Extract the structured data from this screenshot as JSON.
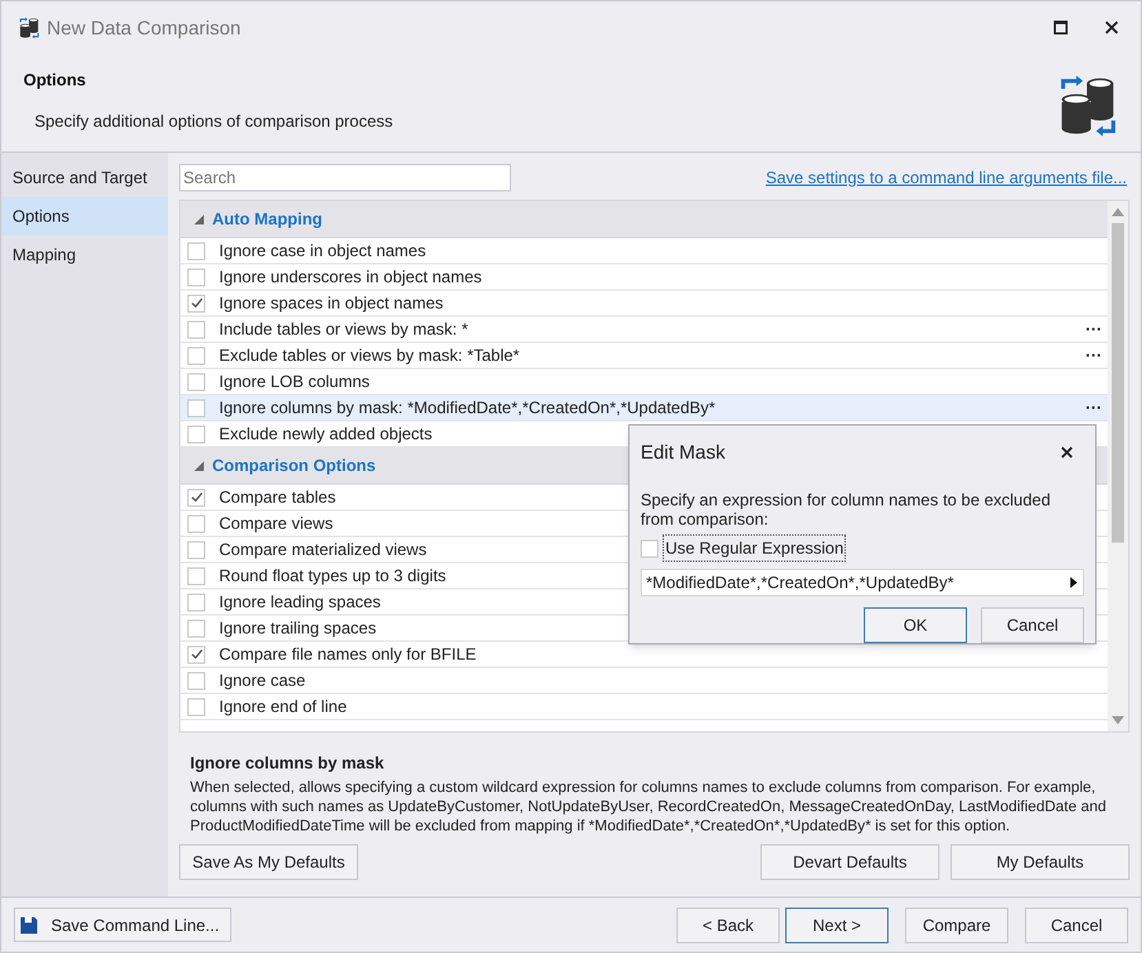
{
  "window": {
    "title": "New Data Comparison"
  },
  "header": {
    "title": "Options",
    "subtitle": "Specify additional options of comparison process"
  },
  "sidebar": {
    "items": [
      {
        "label": "Source and Target",
        "selected": false
      },
      {
        "label": "Options",
        "selected": true
      },
      {
        "label": "Mapping",
        "selected": false
      }
    ]
  },
  "search": {
    "placeholder": "Search"
  },
  "save_link": "Save settings to a command line arguments file...",
  "groups": [
    {
      "title": "Auto Mapping",
      "expanded": true,
      "options": [
        {
          "label": "Ignore case in object names",
          "checked": false,
          "selected": false
        },
        {
          "label": "Ignore underscores in object names",
          "checked": false,
          "selected": false
        },
        {
          "label": "Ignore spaces in object names",
          "checked": true,
          "selected": false
        },
        {
          "label": "Include tables or views by mask: *",
          "checked": false,
          "selected": false,
          "action": "···"
        },
        {
          "label": "Exclude tables or views by mask: *Table*",
          "checked": false,
          "selected": false,
          "action": "···"
        },
        {
          "label": "Ignore LOB columns",
          "checked": false,
          "selected": false
        },
        {
          "label": "Ignore columns by mask: *ModifiedDate*,*CreatedOn*,*UpdatedBy*",
          "checked": false,
          "selected": true,
          "action": "···"
        },
        {
          "label": "Exclude newly added objects",
          "checked": false,
          "selected": false
        }
      ]
    },
    {
      "title": "Comparison Options",
      "expanded": true,
      "options": [
        {
          "label": "Compare tables",
          "checked": true,
          "selected": false
        },
        {
          "label": "Compare views",
          "checked": false,
          "selected": false
        },
        {
          "label": "Compare materialized views",
          "checked": false,
          "selected": false
        },
        {
          "label": "Round float types up to 3 digits",
          "checked": false,
          "selected": false
        },
        {
          "label": "Ignore leading spaces",
          "checked": false,
          "selected": false
        },
        {
          "label": "Ignore trailing spaces",
          "checked": false,
          "selected": false
        },
        {
          "label": "Compare file names only for BFILE",
          "checked": true,
          "selected": false
        },
        {
          "label": "Ignore case",
          "checked": false,
          "selected": false
        },
        {
          "label": "Ignore end of line",
          "checked": false,
          "selected": false
        }
      ]
    }
  ],
  "description": {
    "title": "Ignore columns by mask",
    "text": "When selected, allows specifying a custom wildcard expression for columns names to exclude columns from comparison. For example, columns with such names as UpdateByCustomer, NotUpdateByUser, RecordCreatedOn, MessageCreatedOnDay, LastModifiedDate and ProductModifiedDateTime will be excluded from mapping if *ModifiedDate*,*CreatedOn*,*UpdatedBy* is set for this option."
  },
  "defaults_buttons": {
    "left": "Save As My Defaults",
    "right": [
      "Devart Defaults",
      "My Defaults"
    ]
  },
  "footer": {
    "save_command": "Save Command Line...",
    "buttons": [
      {
        "label": "< Back",
        "default": false
      },
      {
        "label": "Next >",
        "default": true
      },
      {
        "label": "Compare",
        "default": false
      },
      {
        "label": "Cancel",
        "default": false
      }
    ]
  },
  "dialog": {
    "title": "Edit Mask",
    "message": "Specify an expression for column names to be excluded from comparison:",
    "checkbox": {
      "label": "Use Regular Expression",
      "checked": false
    },
    "value": "*ModifiedDate*,*CreatedOn*,*UpdatedBy*",
    "buttons": [
      {
        "label": "OK",
        "default": true
      },
      {
        "label": "Cancel",
        "default": false
      }
    ]
  }
}
